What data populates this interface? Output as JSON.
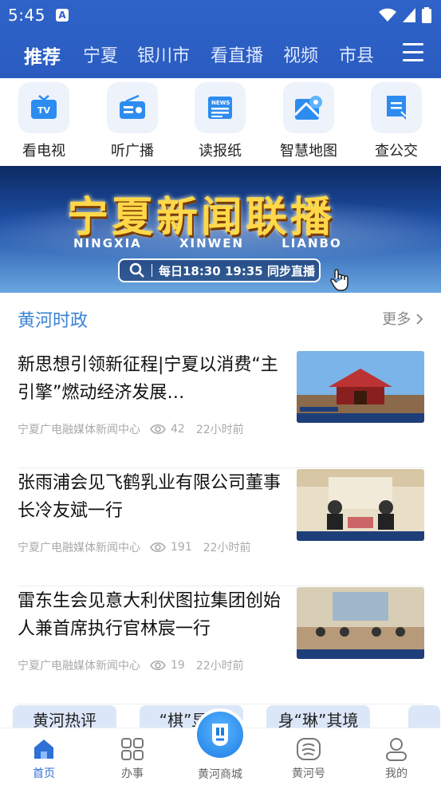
{
  "status": {
    "time": "5:45",
    "notif": "A"
  },
  "tabs": [
    {
      "label": "推荐"
    },
    {
      "label": "宁夏"
    },
    {
      "label": "银川市"
    },
    {
      "label": "看直播"
    },
    {
      "label": "视频"
    },
    {
      "label": "市县"
    }
  ],
  "quick": [
    {
      "label": "看电视",
      "icon": "tv-icon"
    },
    {
      "label": "听广播",
      "icon": "radio-icon"
    },
    {
      "label": "读报纸",
      "icon": "newspaper-icon"
    },
    {
      "label": "智慧地图",
      "icon": "map-icon"
    },
    {
      "label": "查公交",
      "icon": "bus-icon"
    }
  ],
  "banner": {
    "title": "宁夏新闻联播",
    "pinyin": "NINGXIA XINWEN LIANBO",
    "schedule": "每日18:30  19:35 同步直播"
  },
  "section": {
    "title": "黄河时政",
    "more": "更多"
  },
  "news": [
    {
      "headline": "新思想引领新征程|宁夏以消费“主引擎”燃动经济发展…",
      "source": "宁夏广电融媒体新闻中心",
      "views": "42",
      "time": "22小时前"
    },
    {
      "headline": "张雨浦会见飞鹤乳业有限公司董事长冷友斌一行",
      "source": "宁夏广电融媒体新闻中心",
      "views": "191",
      "time": "22小时前"
    },
    {
      "headline": "雷东生会见意大利伏图拉集团创始人兼首席执行官林宸一行",
      "source": "宁夏广电融媒体新闻中心",
      "views": "19",
      "time": "22小时前"
    }
  ],
  "cards": [
    {
      "label": "黄河热评"
    },
    {
      "label": "“棋”显…"
    },
    {
      "label": "身“琳”其境"
    }
  ],
  "bottom": [
    {
      "label": "首页"
    },
    {
      "label": "办事"
    },
    {
      "label": "黄河商城"
    },
    {
      "label": "黄河号"
    },
    {
      "label": "我的"
    }
  ],
  "colors": {
    "brand": "#2f63c8",
    "accent": "#3a83d4",
    "active": "#2f6fd6"
  }
}
